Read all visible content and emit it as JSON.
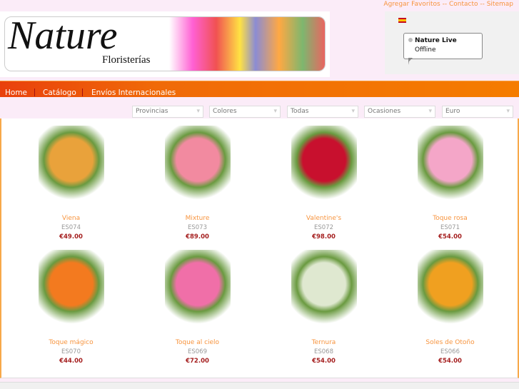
{
  "top_links": [
    "Agregar Favoritos",
    "Contacto",
    "Sitemap"
  ],
  "top_sep": " -- ",
  "logo": {
    "word": "Nature",
    "sub": "Floristerías"
  },
  "chat": {
    "title": "Nature Live",
    "status": "Offline"
  },
  "nav": [
    "Home",
    "Catálogo",
    "Envíos Internacionales"
  ],
  "filters": [
    "Provincias",
    "Colores",
    "Todas",
    "Ocasiones",
    "Euro"
  ],
  "products": [
    {
      "name": "Viena",
      "code": "ES074",
      "price": "€49.00",
      "color": "#e9a23b"
    },
    {
      "name": "Mixture",
      "code": "ES073",
      "price": "€89.00",
      "color": "#f28aa0"
    },
    {
      "name": "Valentine's",
      "code": "ES072",
      "price": "€98.00",
      "color": "#c8102e"
    },
    {
      "name": "Toque rosa",
      "code": "ES071",
      "price": "€54.00",
      "color": "#f4a6c8"
    },
    {
      "name": "Toque mágico",
      "code": "ES070",
      "price": "€44.00",
      "color": "#f37a1f"
    },
    {
      "name": "Toque al cielo",
      "code": "ES069",
      "price": "€72.00",
      "color": "#f06fa8"
    },
    {
      "name": "Ternura",
      "code": "ES068",
      "price": "€54.00",
      "color": "#dfe8d0"
    },
    {
      "name": "Soles de Otoño",
      "code": "ES066",
      "price": "€54.00",
      "color": "#f0a020"
    }
  ]
}
